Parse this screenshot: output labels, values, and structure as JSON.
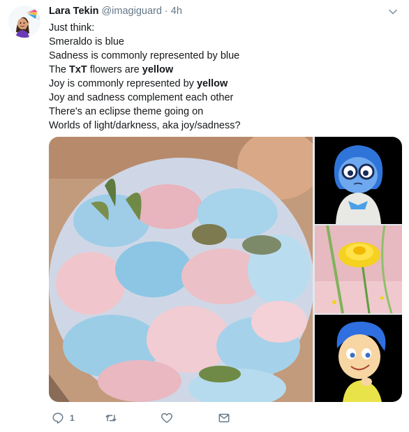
{
  "tweet": {
    "author_name": "Lara Tekin",
    "handle": "@imagiguard",
    "separator": "·",
    "time": "4h",
    "lines": [
      {
        "parts": [
          {
            "text": "Just think:",
            "bold": false
          }
        ]
      },
      {
        "parts": [
          {
            "text": "Smeraldo is blue",
            "bold": false
          }
        ]
      },
      {
        "parts": [
          {
            "text": "Sadness is commonly represented by blue",
            "bold": false
          }
        ]
      },
      {
        "parts": [
          {
            "text": "The ",
            "bold": false
          },
          {
            "text": "TxT",
            "bold": true
          },
          {
            "text": " flowers are ",
            "bold": false
          },
          {
            "text": "yellow",
            "bold": true
          }
        ]
      },
      {
        "parts": [
          {
            "text": "Joy is commonly represented by ",
            "bold": false
          },
          {
            "text": "yellow",
            "bold": true
          }
        ]
      },
      {
        "parts": [
          {
            "text": "Joy and sadness complement each other",
            "bold": false
          }
        ]
      },
      {
        "parts": [
          {
            "text": "There's an eclipse theme going on",
            "bold": false
          }
        ]
      },
      {
        "parts": [
          {
            "text": "Worlds of light/darkness, aka joy/sadness?",
            "bold": false
          }
        ]
      }
    ],
    "media": [
      {
        "name": "photo-blue-pink-petals"
      },
      {
        "name": "photo-sadness-character"
      },
      {
        "name": "photo-yellow-flower"
      },
      {
        "name": "photo-joy-character"
      }
    ],
    "actions": {
      "reply_count": "1",
      "retweet_count": "",
      "like_count": ""
    },
    "icons": {
      "caret": "chevron-down-icon",
      "reply": "reply-icon",
      "retweet": "retweet-icon",
      "like": "heart-icon",
      "message": "envelope-icon"
    },
    "colors": {
      "text": "#14171a",
      "secondary": "#657786",
      "sadness_blue": "#2f74d8",
      "joy_yellow": "#f5d21f"
    }
  }
}
